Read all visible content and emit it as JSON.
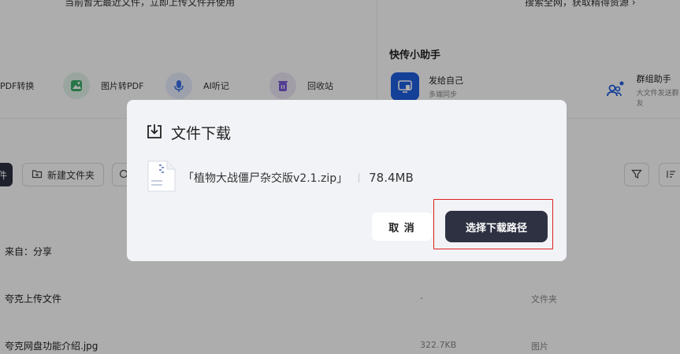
{
  "top_bar": {
    "left_text": "当前暂无最近文件，立即上传文件并使用",
    "right_text": "搜索全网，获取精得资源 ›"
  },
  "tools": [
    {
      "label": "PDF转换",
      "icon": "pdf-convert-icon",
      "color": "#e8eefc"
    },
    {
      "label": "图片转PDF",
      "icon": "image-to-pdf-icon",
      "color": "#e3f4ea"
    },
    {
      "label": "AI听记",
      "icon": "microphone-icon",
      "color": "#e8eefc"
    },
    {
      "label": "回收站",
      "icon": "trash-icon",
      "color": "#ece8f7"
    }
  ],
  "helper": {
    "title": "快传小助手",
    "items": [
      {
        "name": "发给自己",
        "sub": "多端同步",
        "icon": "monitor-icon",
        "color": "#1f5fe0"
      },
      {
        "name": "群组助手",
        "sub": "大文件发送群友",
        "icon": "group-icon",
        "color": "#ffffff"
      }
    ]
  },
  "toolbar": {
    "dark_label": "件",
    "new_folder_label": "新建文件夹"
  },
  "rows": [
    {
      "name": "来自：分享",
      "size": "",
      "type": ""
    },
    {
      "name": "夸克上传文件",
      "size": "-",
      "type": "文件夹"
    },
    {
      "name": "夸克网盘功能介绍.jpg",
      "size": "322.7KB",
      "type": "图片"
    }
  ],
  "misc": {
    "mark": "!"
  },
  "dialog": {
    "title": "文件下载",
    "file_name": "「植物大战僵尸杂交版v2.1.zip」",
    "file_size": "78.4MB",
    "cancel_label": "取 消",
    "confirm_label": "选择下载路径"
  },
  "colors": {
    "accent": "#2d3142",
    "highlight_border": "#e02020",
    "brand_blue": "#1f5fe0"
  }
}
